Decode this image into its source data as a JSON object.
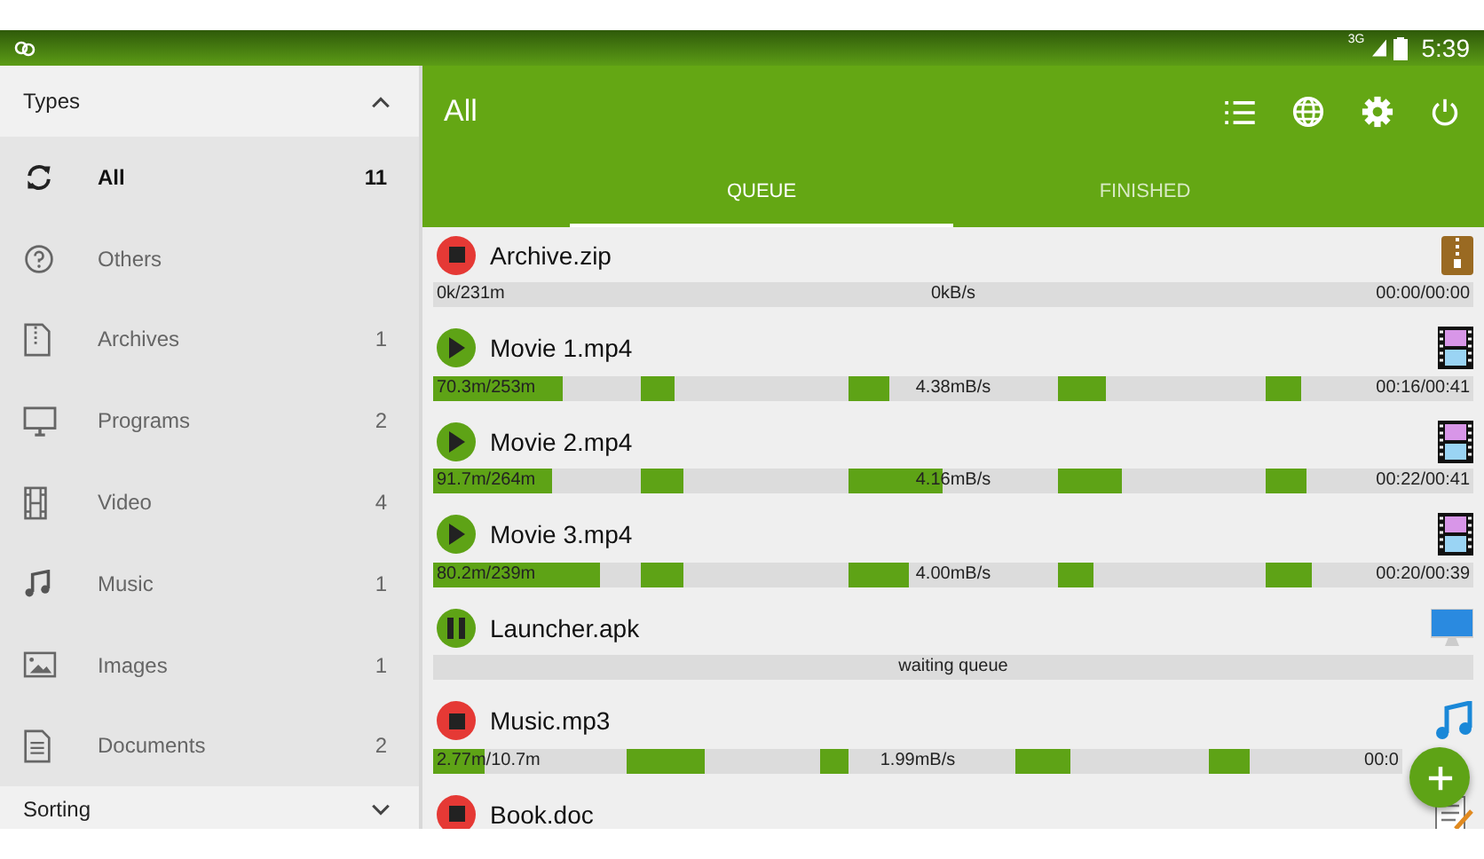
{
  "status_bar": {
    "network": "3G",
    "time": "5:39"
  },
  "sidebar": {
    "header": {
      "label": "Types",
      "expanded": true
    },
    "items": [
      {
        "kind": "all",
        "label": "All",
        "count": "11",
        "selected": true
      },
      {
        "kind": "others",
        "label": "Others",
        "selected": false
      },
      {
        "kind": "archive",
        "label": "Archives",
        "count": "1",
        "selected": false
      },
      {
        "kind": "program",
        "label": "Programs",
        "count": "2",
        "selected": false
      },
      {
        "kind": "video",
        "label": "Video",
        "count": "4",
        "selected": false
      },
      {
        "kind": "music",
        "label": "Music",
        "count": "1",
        "selected": false
      },
      {
        "kind": "image",
        "label": "Images",
        "count": "1",
        "selected": false
      },
      {
        "kind": "document",
        "label": "Documents",
        "count": "2",
        "selected": false
      }
    ],
    "footer": {
      "label": "Sorting",
      "expanded": false
    }
  },
  "app_bar": {
    "title": "All"
  },
  "tabs": [
    {
      "label": "QUEUE",
      "selected": true
    },
    {
      "label": "FINISHED",
      "selected": false
    }
  ],
  "downloads": [
    {
      "name": "Archive.zip",
      "button": {
        "kind": "stop"
      },
      "kind": "archive",
      "size": "0k/231m",
      "speed": "0kB/s",
      "time": "00:00/00:00",
      "parts": [
        {
          "level": 0
        }
      ]
    },
    {
      "name": "Movie 1.mp4",
      "button": {
        "kind": "play"
      },
      "kind": "video",
      "size": "70.3m/253m",
      "speed": "4.38mB/s",
      "time": "00:16/00:41",
      "parts": [
        {
          "level": 0.62
        },
        {
          "level": 0.16
        },
        {
          "level": 0.19
        },
        {
          "level": 0.23
        },
        {
          "level": 0.17
        }
      ]
    },
    {
      "name": "Movie 2.mp4",
      "button": {
        "kind": "play"
      },
      "kind": "video",
      "size": "91.7m/264m",
      "speed": "4.16mB/s",
      "time": "00:22/00:41",
      "parts": [
        {
          "level": 0.57
        },
        {
          "level": 0.2
        },
        {
          "level": 0.45
        },
        {
          "level": 0.31
        },
        {
          "level": 0.2
        }
      ]
    },
    {
      "name": "Movie 3.mp4",
      "button": {
        "kind": "play"
      },
      "kind": "video",
      "size": "80.2m/239m",
      "speed": "4.00mB/s",
      "time": "00:20/00:39",
      "parts": [
        {
          "level": 0.8
        },
        {
          "level": 0.2
        },
        {
          "level": 0.29
        },
        {
          "level": 0.17
        },
        {
          "level": 0.22
        }
      ]
    },
    {
      "name": "Launcher.apk",
      "button": {
        "kind": "pause"
      },
      "kind": "program",
      "message": "waiting queue",
      "parts": [
        {
          "level": 0
        }
      ]
    },
    {
      "name": "Music.mp3",
      "button": {
        "kind": "stop"
      },
      "kind": "music",
      "size": "2.77m/10.7m",
      "speed": "1.99mB/s",
      "time": "00:0",
      "parts": [
        {
          "level": 0.27
        },
        {
          "level": 0.4
        },
        {
          "level": 0.14
        },
        {
          "level": 0.29
        },
        {
          "level": 0.21
        }
      ]
    },
    {
      "name": "Book.doc",
      "button": {
        "kind": "stop"
      },
      "kind": "document"
    }
  ]
}
